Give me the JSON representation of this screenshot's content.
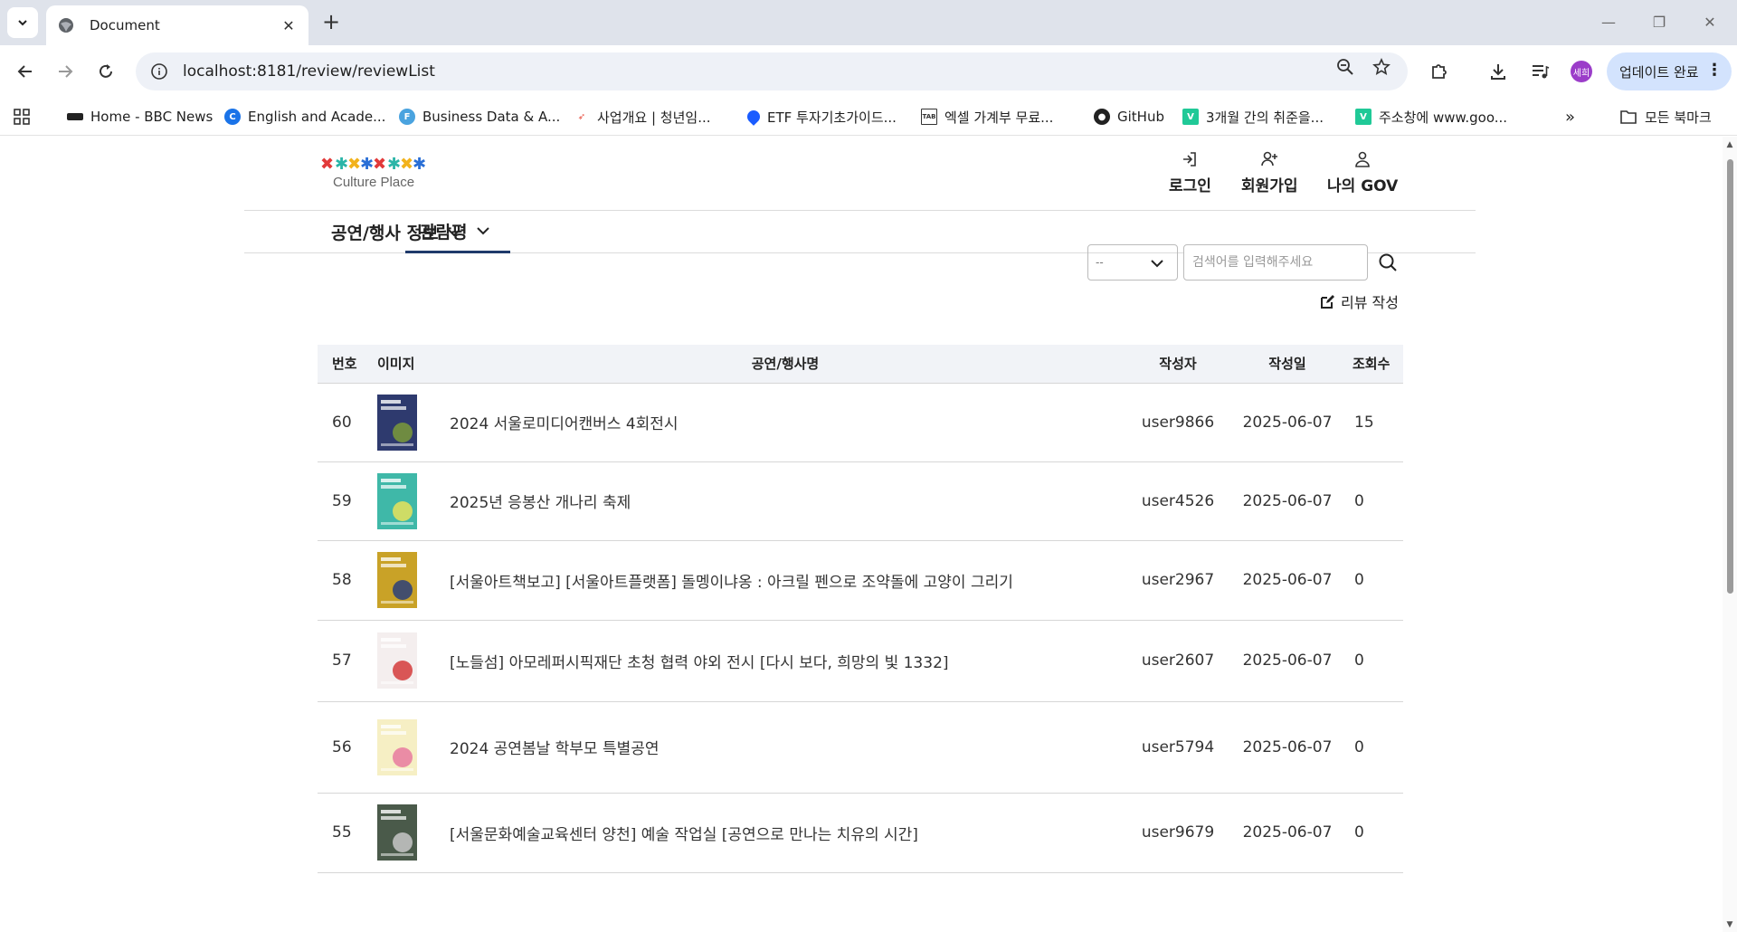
{
  "browser": {
    "tab_title": "Document",
    "url": "localhost:8181/review/reviewList",
    "profile_label": "세희",
    "update_label": "업데이트 완료",
    "bookmarks": [
      {
        "label": "Home - BBC News",
        "icon": "bbc-icon",
        "color": "#222222"
      },
      {
        "label": "English and Acade...",
        "icon": "c-icon",
        "color": "#1a73e8"
      },
      {
        "label": "Business Data & A...",
        "icon": "f-icon",
        "color": "#4aa3df"
      },
      {
        "label": "사업개요 | 청년임...",
        "icon": "arrow-logo-icon",
        "color": "#e74c3c"
      },
      {
        "label": "ETF 투자기초가이드...",
        "icon": "pin-icon",
        "color": "#1a5cff"
      },
      {
        "label": "엑셀 가계부 무료...",
        "icon": "tab-icon",
        "color": "#333333"
      },
      {
        "label": "GitHub",
        "icon": "github-icon",
        "color": "#222222"
      },
      {
        "label": "3개월 간의 취준을...",
        "icon": "v-icon",
        "color": "#20c997"
      },
      {
        "label": "주소창에 www.goo...",
        "icon": "v-icon",
        "color": "#20c997"
      }
    ],
    "all_bookmarks_label": "모든 북마크"
  },
  "header": {
    "logo_text": "Culture Place",
    "links": [
      {
        "label": "로그인",
        "icon": "login-icon"
      },
      {
        "label": "회원가입",
        "icon": "add-user-icon"
      },
      {
        "label": "나의 GOV",
        "icon": "user-icon"
      }
    ]
  },
  "nav": {
    "items": [
      {
        "label": "공연/행사 정보",
        "active": false
      },
      {
        "label": "관람평",
        "active": true
      }
    ]
  },
  "search": {
    "select_value": "--",
    "placeholder": "검색어를 입력해주세요",
    "write_label": "리뷰 작성"
  },
  "table": {
    "headers": [
      "번호",
      "이미지",
      "공연/행사명",
      "작성자",
      "작성일",
      "조회수"
    ],
    "rows": [
      {
        "no": "60",
        "title": "2024 서울로미디어캔버스 4회전시",
        "writer": "user9866",
        "date": "2025-06-07",
        "views": "15",
        "thumb_colors": [
          "#2e3a6e",
          "#7a9a3a"
        ]
      },
      {
        "no": "59",
        "title": "2025년 응봉산 개나리 축제",
        "writer": "user4526",
        "date": "2025-06-07",
        "views": "0",
        "thumb_colors": [
          "#3fb8a8",
          "#e8e25a"
        ]
      },
      {
        "no": "58",
        "title": "[서울아트책보고] [서울아트플랫폼] 돌멩이냐옹 : 아크릴 펜으로 조약돌에 고양이 그리기",
        "writer": "user2967",
        "date": "2025-06-07",
        "views": "0",
        "thumb_colors": [
          "#c9a227",
          "#2b3f7a"
        ]
      },
      {
        "no": "57",
        "title": "[노들섬] 아모레퍼시픽재단 초청 협력 야외 전시 [다시 보다, 희망의 빛 1332]",
        "writer": "user2607",
        "date": "2025-06-07",
        "views": "0",
        "thumb_colors": [
          "#f4eeee",
          "#d43b3b"
        ]
      },
      {
        "no": "56",
        "title": "2024 공연봄날 학부모 특별공연",
        "writer": "user5794",
        "date": "2025-06-07",
        "views": "0",
        "thumb_colors": [
          "#f6efc4",
          "#e77aa0"
        ]
      },
      {
        "no": "55",
        "title": "[서울문화예술교육센터 양천] 예술 작업실 [공연으로 만나는 치유의 시간]",
        "writer": "user9679",
        "date": "2025-06-07",
        "views": "0",
        "thumb_colors": [
          "#4a5a4a",
          "#c7c7c7"
        ]
      }
    ]
  }
}
